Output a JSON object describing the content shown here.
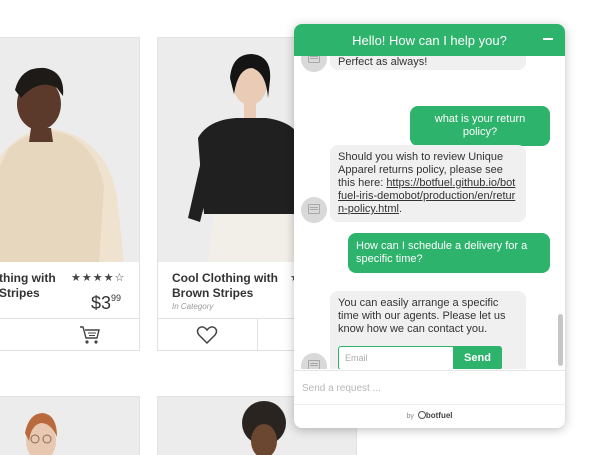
{
  "products": [
    {
      "title": "Cool Clothing with Brown Stripes",
      "visible_title": "thing with\nStripes",
      "stars": "★★★★☆",
      "price_whole": "$3",
      "price_cents": "99"
    },
    {
      "title": "Cool Clothing with Brown Stripes",
      "category": "In Category",
      "stars": "★"
    }
  ],
  "chat": {
    "header_title": "Hello! How can I help you?",
    "messages": [
      {
        "from": "bot",
        "text": "Perfect as always!"
      },
      {
        "from": "user",
        "text": "what is your return policy?"
      },
      {
        "from": "bot",
        "text_prefix": "Should you wish to review Unique Apparel returns policy, please see this here: ",
        "link": "https://botfuel.github.io/botfuel-iris-demobot/production/en/return-policy.html",
        "text_suffix": "."
      },
      {
        "from": "user",
        "text": "How can I schedule a delivery for a specific time?"
      },
      {
        "from": "bot",
        "text": "You can easily arrange a specific time with our agents. Please let us know how we can contact you."
      }
    ],
    "email_placeholder": "Email",
    "send_label": "Send",
    "request_placeholder": "Send a request ...",
    "footer_by": "by",
    "footer_brand": "botfuel"
  },
  "colors": {
    "accent": "#2db36b",
    "bot_bubble": "#f0f0f0",
    "text": "#333333"
  },
  "icons": [
    "cart-icon",
    "heart-icon",
    "bot-avatar-icon",
    "minimize-icon",
    "botfuel-logo-icon"
  ]
}
